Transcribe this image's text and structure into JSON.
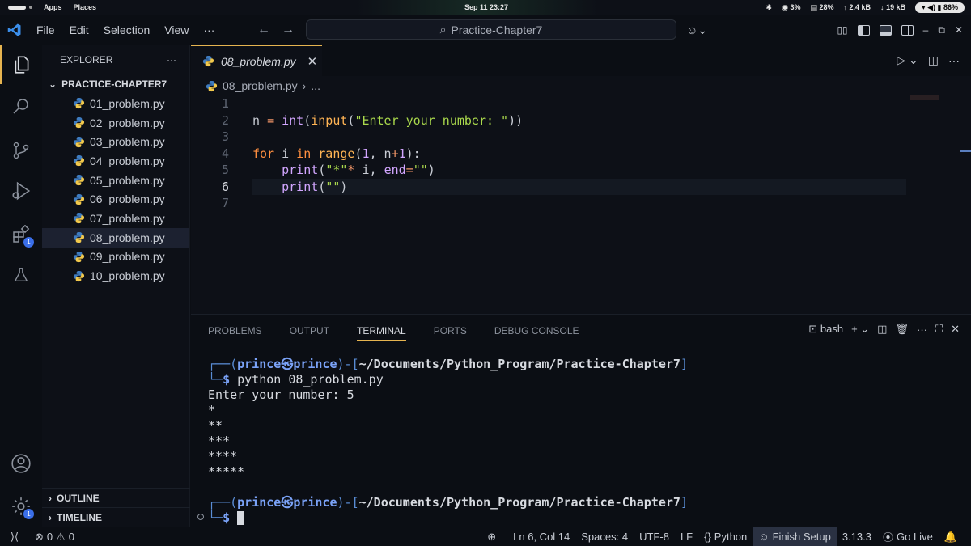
{
  "os": {
    "menu_apps": "Apps",
    "menu_places": "Places",
    "clock": "Sep 11  23:27",
    "cpu": "3%",
    "mem": "28%",
    "net_up": "2.4 kB",
    "net_down": "19 kB",
    "battery": "86%"
  },
  "titlebar": {
    "menus": [
      "File",
      "Edit",
      "Selection",
      "View",
      "···"
    ],
    "search": "Practice-Chapter7"
  },
  "sidebar": {
    "title": "EXPLORER",
    "more": "···",
    "folder": "PRACTICE-CHAPTER7",
    "files": [
      "01_problem.py",
      "02_problem.py",
      "03_problem.py",
      "04_problem.py",
      "05_problem.py",
      "06_problem.py",
      "07_problem.py",
      "08_problem.py",
      "09_problem.py",
      "10_problem.py"
    ],
    "selected_index": 7,
    "outline": "OUTLINE",
    "timeline": "TIMELINE"
  },
  "activity": {
    "extensions_badge": "1",
    "settings_badge": "1"
  },
  "editor": {
    "tab_label": "08_problem.py",
    "breadcrumb_file": "08_problem.py",
    "breadcrumb_more": "...",
    "line_numbers": [
      "1",
      "2",
      "3",
      "4",
      "5",
      "6",
      "7"
    ],
    "current_line": 6
  },
  "panel": {
    "tabs": [
      "PROBLEMS",
      "OUTPUT",
      "TERMINAL",
      "PORTS",
      "DEBUG CONSOLE"
    ],
    "active_tab": "TERMINAL",
    "shell": "bash",
    "prompt_user": "prince",
    "prompt_host": "prince",
    "prompt_path": "~/Documents/Python_Program/Practice-Chapter7",
    "command": "python 08_problem.py",
    "output": [
      "Enter your number: 5",
      "*",
      "**",
      "***",
      "****",
      "*****"
    ]
  },
  "statusbar": {
    "errors": "0",
    "warnings": "0",
    "position": "Ln 6, Col 14",
    "spaces": "Spaces: 4",
    "encoding": "UTF-8",
    "eol": "LF",
    "language": "Python",
    "finish_setup": "Finish Setup",
    "python_version": "3.13.3",
    "go_live": "Go Live"
  },
  "colors": {
    "accent": "#e6b450",
    "background": "#0d1017",
    "badge": "#3a6ee8"
  }
}
